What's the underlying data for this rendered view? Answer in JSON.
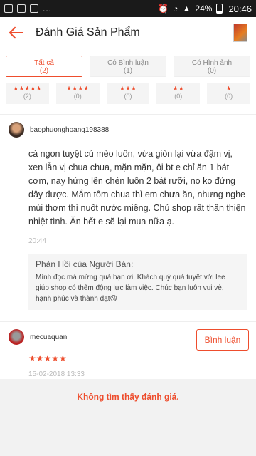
{
  "status_bar": {
    "dots": "...",
    "battery": "24%",
    "time": "20:46"
  },
  "header": {
    "title": "Đánh Giá Sản Phẩm"
  },
  "filters": {
    "tabs": [
      {
        "label": "Tất cả",
        "count": "(2)"
      },
      {
        "label": "Có Bình luận",
        "count": "(1)"
      },
      {
        "label": "Có Hình ảnh",
        "count": "(0)"
      }
    ],
    "stars": [
      {
        "stars": "★★★★★",
        "count": "(2)"
      },
      {
        "stars": "★★★★",
        "count": "(0)"
      },
      {
        "stars": "★★★",
        "count": "(0)"
      },
      {
        "stars": "★★",
        "count": "(0)"
      },
      {
        "stars": "★",
        "count": "(0)"
      }
    ]
  },
  "review1": {
    "username": "baophuonghoang198388",
    "text": "cà ngon tuyệt cú mèo luôn, vừa giòn lại vừa đậm vị, xen lẫn vị chua chua, mặn mặn, ôi bt e chỉ ăn 1 bát cơm, nay hứng lên chén luôn 2 bát rưỡi, no ko đứng dậy được. Mắm tôm chua thì em chưa ăn, nhưng nghe mùi thơm thì nuốt nước miếng. Chủ shop rất thân thiện nhiệt tình. Ăn hết e sẽ lại mua nữa ạ.",
    "time": "20:44",
    "reply_title": "Phản Hồi của Người Bán:",
    "reply_text": "Mình đọc mà mừng quá bạn ơi. Khách quý quá tuyệt vời lee giúp shop có thêm động lực làm việc. Chúc bạn luôn vui vẻ, hạnh phúc và thành đạt😘"
  },
  "review2": {
    "username": "mecuaquan",
    "stars": "★★★★★",
    "time": "15-02-2018 13:33",
    "comment_label": "Bình luận"
  },
  "footer": {
    "empty_text": "Không tìm thấy đánh giá."
  }
}
